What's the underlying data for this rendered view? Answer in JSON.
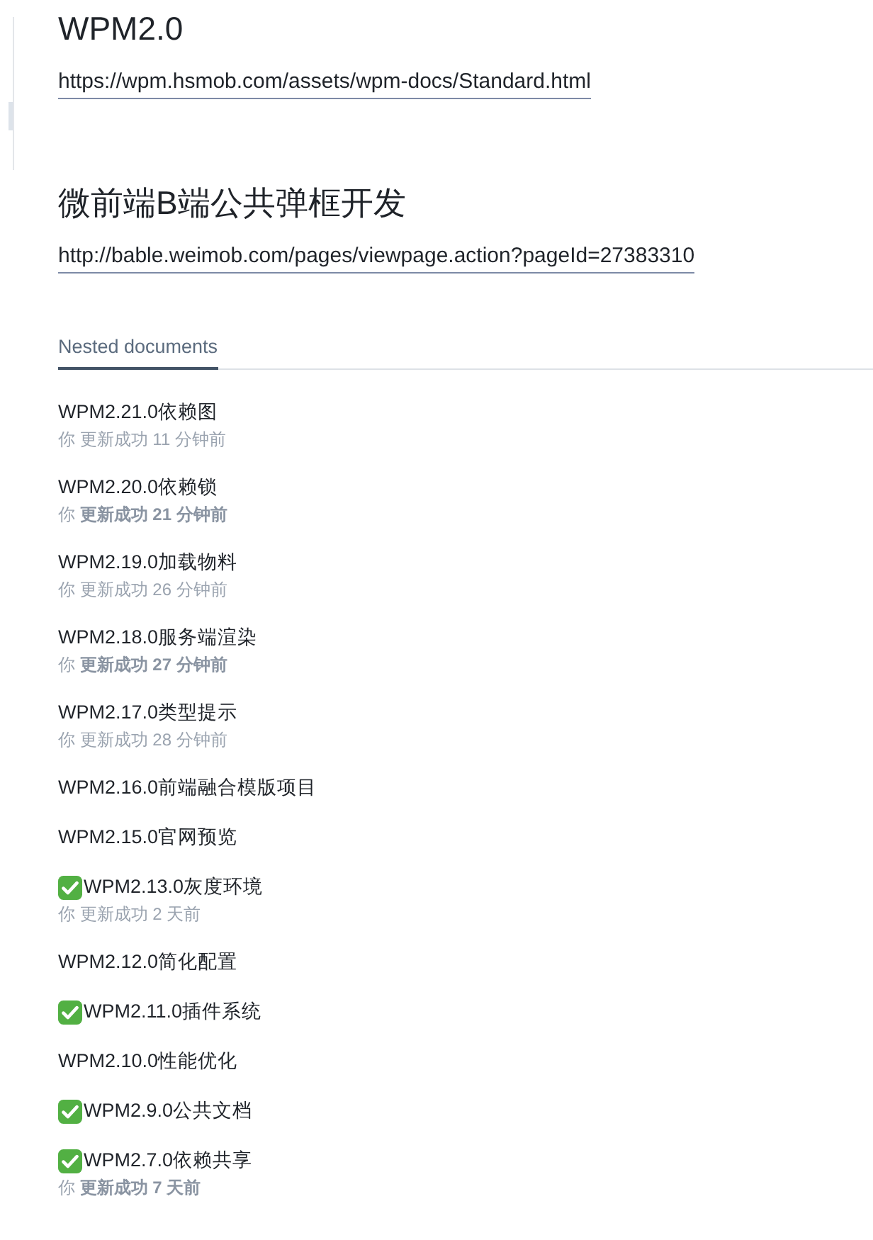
{
  "sections": [
    {
      "title": "WPM2.0",
      "link": "https://wpm.hsmob.com/assets/wpm-docs/Standard.html"
    },
    {
      "title": "微前端B端公共弹框开发",
      "link": "http://bable.weimob.com/pages/viewpage.action?pageId=27383310"
    }
  ],
  "tabs": [
    {
      "label": "Nested documents",
      "selected": true
    }
  ],
  "documents": [
    {
      "title": "WPM2.21.0依赖图",
      "done": false,
      "meta": "你 更新成功 11 分钟前"
    },
    {
      "title": "WPM2.20.0依赖锁",
      "done": false,
      "meta": "你 **更新成功 21 分钟前**"
    },
    {
      "title": "WPM2.19.0加载物料",
      "done": false,
      "meta": "你 更新成功 26 分钟前"
    },
    {
      "title": "WPM2.18.0服务端渲染",
      "done": false,
      "meta": "你 **更新成功 27 分钟前**"
    },
    {
      "title": "WPM2.17.0类型提示",
      "done": false,
      "meta": "你 更新成功 28 分钟前"
    },
    {
      "title": "WPM2.16.0前端融合模版项目",
      "done": false
    },
    {
      "title": "WPM2.15.0官网预览",
      "done": false
    },
    {
      "title": "WPM2.13.0灰度环境",
      "done": true,
      "meta": "你 更新成功 2 天前"
    },
    {
      "title": "WPM2.12.0简化配置",
      "done": false
    },
    {
      "title": "WPM2.11.0插件系统",
      "done": true
    },
    {
      "title": "WPM2.10.0性能优化",
      "done": false
    },
    {
      "title": "WPM2.9.0公共文档",
      "done": true
    },
    {
      "title": "WPM2.7.0依赖共享",
      "done": true,
      "meta": "你 **更新成功 7 天前**"
    }
  ]
}
